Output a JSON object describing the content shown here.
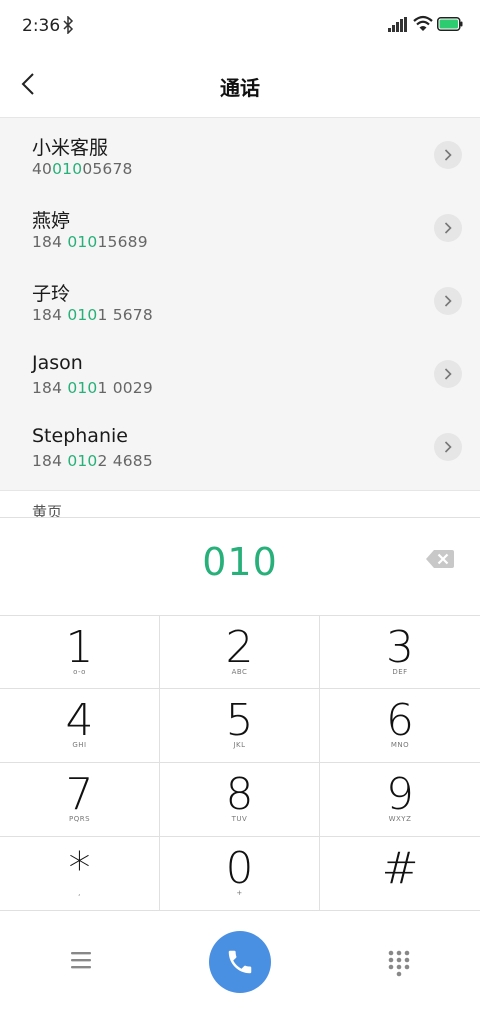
{
  "status": {
    "time": "2:36"
  },
  "header": {
    "title": "通话"
  },
  "contacts": [
    {
      "name": "小米客服",
      "number_pre": "40",
      "number_hl": "010",
      "number_post": "05678"
    },
    {
      "name": "燕婷",
      "number_pre": "184 ",
      "number_hl": "010",
      "number_post": "15689"
    },
    {
      "name": "子玲",
      "number_pre": "184 ",
      "number_hl": "010",
      "number_post": "1 5678"
    },
    {
      "name": "Jason",
      "number_pre": "184 ",
      "number_hl": "010",
      "number_post": "1 0029"
    },
    {
      "name": "Stephanie",
      "number_pre": "184 ",
      "number_hl": "010",
      "number_post": "2 4685"
    }
  ],
  "yellowpages": {
    "label": "黄页"
  },
  "dialer": {
    "digits": "010"
  },
  "keypad": [
    {
      "digit": "1",
      "letters": "o-o"
    },
    {
      "digit": "2",
      "letters": "ABC"
    },
    {
      "digit": "3",
      "letters": "DEF"
    },
    {
      "digit": "4",
      "letters": "GHI"
    },
    {
      "digit": "5",
      "letters": "JKL"
    },
    {
      "digit": "6",
      "letters": "MNO"
    },
    {
      "digit": "7",
      "letters": "PQRS"
    },
    {
      "digit": "8",
      "letters": "TUV"
    },
    {
      "digit": "9",
      "letters": "WXYZ"
    },
    {
      "digit": "*",
      "letters": ","
    },
    {
      "digit": "0",
      "letters": "+"
    },
    {
      "digit": "#",
      "letters": ""
    }
  ],
  "colors": {
    "accent_green": "#27b07a",
    "call_blue": "#4a90e2",
    "battery_green": "#2ecc71"
  },
  "icons": [
    "bluetooth-icon",
    "signal-icon",
    "wifi-icon",
    "battery-icon",
    "back-arrow-icon",
    "chevron-right-icon",
    "backspace-icon",
    "menu-icon",
    "phone-icon",
    "dialpad-icon"
  ]
}
